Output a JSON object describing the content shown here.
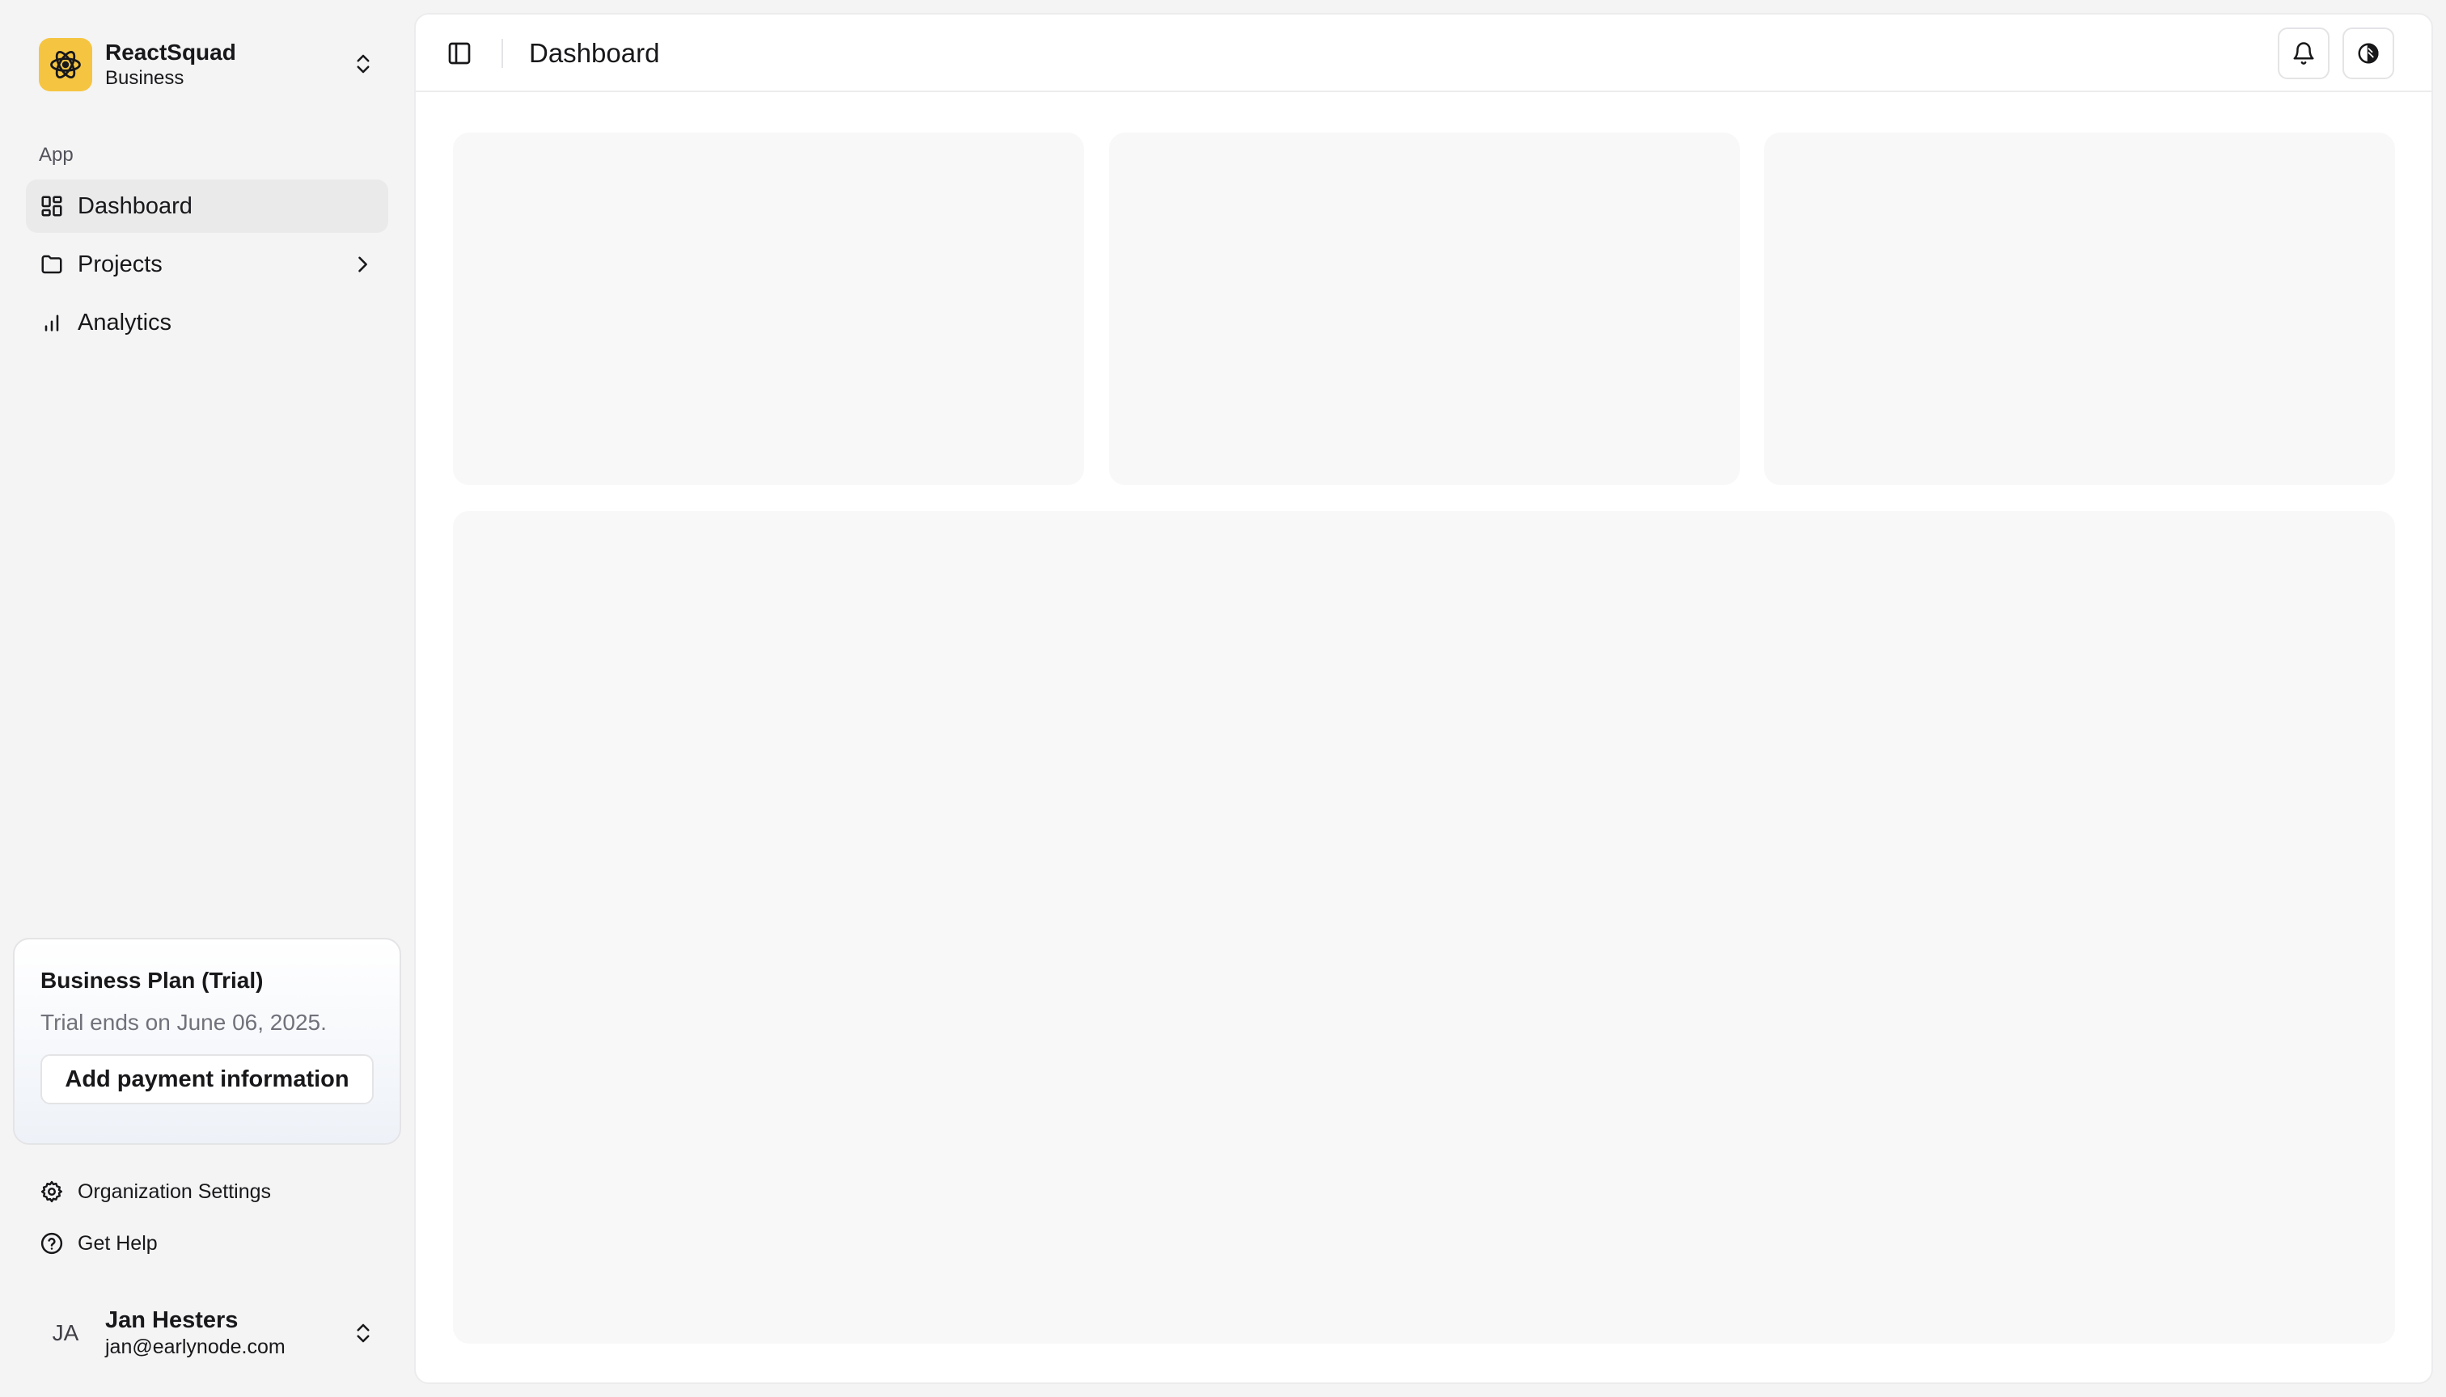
{
  "org": {
    "name": "ReactSquad",
    "plan": "Business"
  },
  "sidebar": {
    "section_label": "App",
    "items": [
      {
        "label": "Dashboard",
        "icon": "dashboard-icon",
        "active": true
      },
      {
        "label": "Projects",
        "icon": "folder-icon",
        "has_submenu": true
      },
      {
        "label": "Analytics",
        "icon": "bar-chart-icon"
      }
    ]
  },
  "plan_card": {
    "title": "Business Plan (Trial)",
    "subtitle": "Trial ends on June 06, 2025.",
    "button_label": "Add payment information"
  },
  "footer_links": [
    {
      "label": "Organization Settings",
      "icon": "gear-icon"
    },
    {
      "label": "Get Help",
      "icon": "help-circle-icon"
    }
  ],
  "user": {
    "initials": "JA",
    "name": "Jan Hesters",
    "email": "jan@earlynode.com"
  },
  "header": {
    "title": "Dashboard"
  },
  "colors": {
    "brand": "#f5c542",
    "skeleton": "#f8f8f8",
    "sidebar_bg": "#f4f4f5"
  }
}
